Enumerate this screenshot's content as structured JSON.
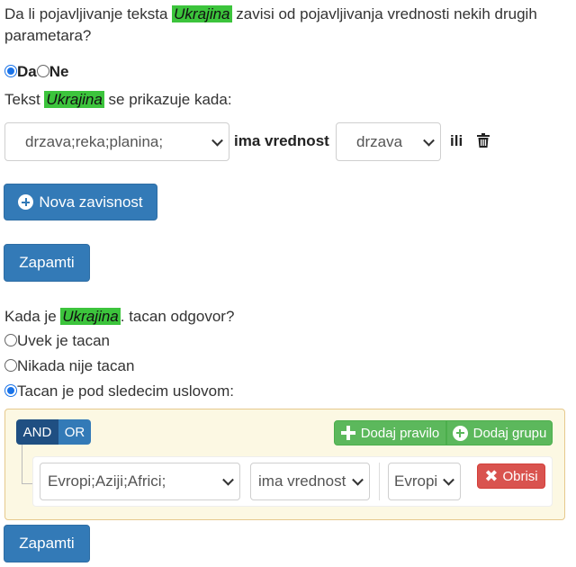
{
  "question": {
    "intro": "Da li pojavljivanje teksta",
    "highlight": "Ukrajina",
    "rest_line1": "zavisi od pojavljivanja vrednosti nekih drugih",
    "line2": "parametara?"
  },
  "dependency_radio": {
    "yes": "Da",
    "no": "Ne"
  },
  "shown_when": {
    "prefix": "Tekst",
    "highlight": "Ukrajina",
    "suffix": "se prikazuje kada:"
  },
  "dependency_row": {
    "param_select": "drzava;reka;planina;",
    "has_value_label": "ima vrednost",
    "value_select": "drzava",
    "or_label": "ili"
  },
  "buttons": {
    "new_dependency": "Nova zavisnost",
    "save_1": "Zapamti",
    "save_2": "Zapamti"
  },
  "correct_answer": {
    "prefix": "Kada je",
    "highlight": "Ukrajina",
    "suffix": ". tacan odgovor?",
    "options": [
      "Uvek je tacan",
      "Nikada nije tacan",
      "Tacan je pod sledecim uslovom:"
    ],
    "selected": 2
  },
  "query_builder": {
    "and_label": "AND",
    "or_label": "OR",
    "add_rule": "Dodaj pravilo",
    "add_group": "Dodaj grupu",
    "rule": {
      "field": "Evropi;Aziji;Africi;",
      "operator": "ima vrednost",
      "value": "Evropi",
      "delete": "Obrisi"
    }
  },
  "colors": {
    "highlight": "#3cc43c",
    "primary": "#337ab7",
    "success": "#5cb85c",
    "danger": "#d9534f",
    "group_bg": "#fcf8e3",
    "and_active": "#1f4f82"
  }
}
